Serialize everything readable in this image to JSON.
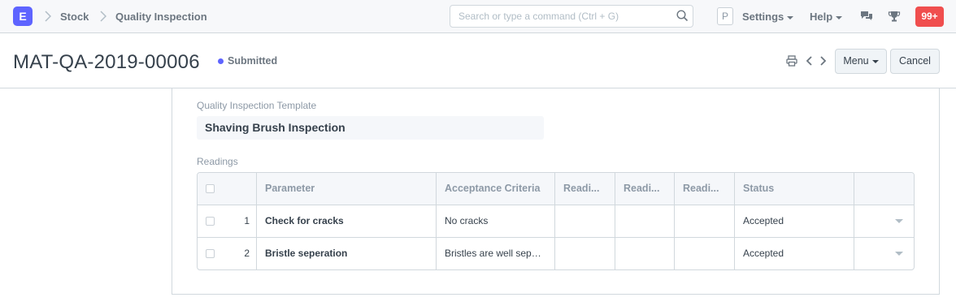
{
  "navbar": {
    "logo_letter": "E",
    "breadcrumbs": [
      "Stock",
      "Quality Inspection"
    ],
    "search_placeholder": "Search or type a command (Ctrl + G)",
    "avatar_letter": "P",
    "settings_label": "Settings",
    "help_label": "Help",
    "notification_count": "99+"
  },
  "page": {
    "title": "MAT-QA-2019-00006",
    "status": "Submitted",
    "status_color": "#5e64ff",
    "menu_label": "Menu",
    "cancel_label": "Cancel"
  },
  "form": {
    "template_label": "Quality Inspection Template",
    "template_value": "Shaving Brush Inspection",
    "readings_label": "Readings"
  },
  "readings": {
    "columns": [
      "Parameter",
      "Acceptance Criteria",
      "Readi...",
      "Readi...",
      "Readi...",
      "Status"
    ],
    "rows": [
      {
        "idx": "1",
        "parameter": "Check for cracks",
        "criteria": "No cracks",
        "r1": "",
        "r2": "",
        "r3": "",
        "status": "Accepted"
      },
      {
        "idx": "2",
        "parameter": "Bristle seperation",
        "criteria": "Bristles are well separated",
        "r1": "",
        "r2": "",
        "r3": "",
        "status": "Accepted"
      }
    ]
  },
  "colors": {
    "brand": "#5e64ff",
    "notification": "#f04e4e"
  },
  "icons": [
    "chevron-right-icon",
    "search-icon",
    "comment-icon",
    "trophy-icon",
    "print-icon",
    "chevron-left-icon",
    "caret-down-icon"
  ]
}
